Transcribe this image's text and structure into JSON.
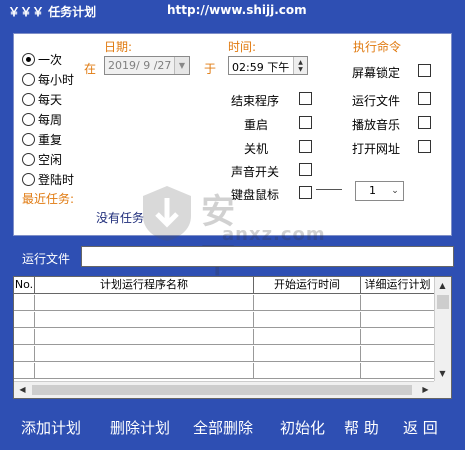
{
  "title": "￥￥￥ 任务计划",
  "url": "http://www.shijj.com",
  "schedule_options": [
    {
      "label": "一次",
      "selected": true
    },
    {
      "label": "每小时",
      "selected": false
    },
    {
      "label": "每天",
      "selected": false
    },
    {
      "label": "每周",
      "selected": false
    },
    {
      "label": "重复",
      "selected": false
    },
    {
      "label": "空闲",
      "selected": false
    },
    {
      "label": "登陆时",
      "selected": false
    }
  ],
  "date": {
    "label": "日期:",
    "at": "在",
    "value": "2019/ 9 /27"
  },
  "time": {
    "label": "时间:",
    "at": "于",
    "value": "02:59 下午"
  },
  "exec_command_label": "执行命令",
  "actions_left": [
    "结束程序",
    "重启",
    "关机",
    "声音开关",
    "键盘鼠标"
  ],
  "actions_right": [
    "屏幕锁定",
    "运行文件",
    "播放音乐",
    "打开网址"
  ],
  "keyboard_count": "1",
  "recent_tasks": {
    "label": "最近任务:",
    "value": "没有任务"
  },
  "watermark": {
    "text": "安下载",
    "url": "anxz.com"
  },
  "run_file": {
    "label": "运行文件",
    "value": ""
  },
  "table": {
    "headers": [
      "No.",
      "计划运行程序名称",
      "开始运行时间",
      "详细运行计划"
    ],
    "rows": 5
  },
  "footer_buttons": [
    "添加计划",
    "删除计划",
    "全部删除",
    "初始化",
    "帮 助",
    "返 回"
  ],
  "colors": {
    "background": "#2e4fb3",
    "accent_orange": "#e07a10",
    "navy_text": "#1e2c7a"
  }
}
